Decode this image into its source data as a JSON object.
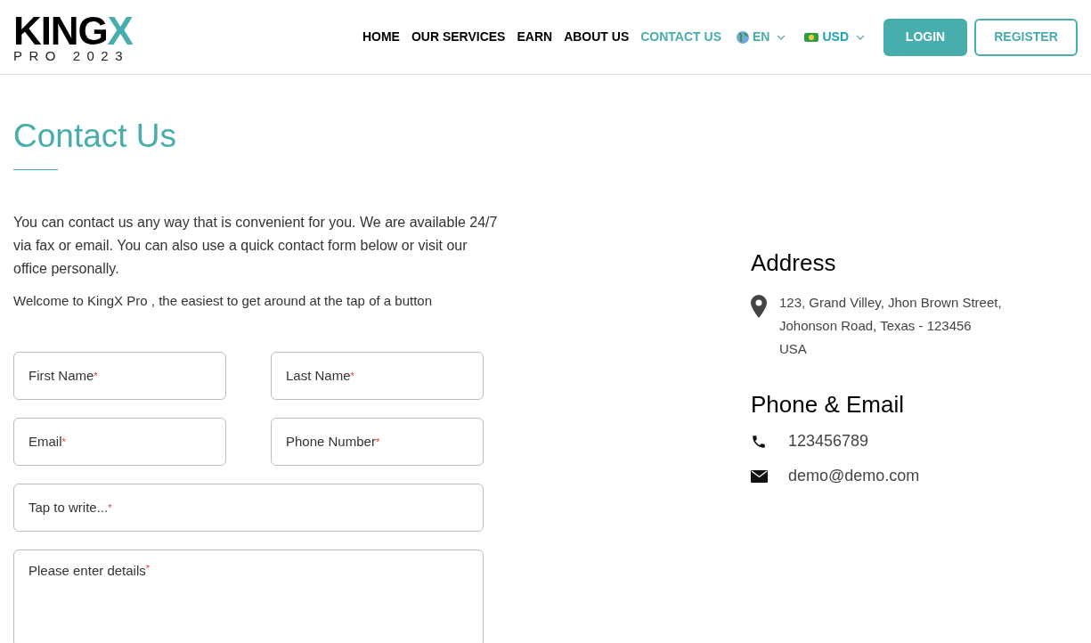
{
  "logo": {
    "main": "KING",
    "accent": "X",
    "sub": "PRO 2023"
  },
  "nav": [
    {
      "label": "HOME",
      "selected": false
    },
    {
      "label": "OUR SERVICES",
      "selected": false
    },
    {
      "label": "EARN",
      "selected": false
    },
    {
      "label": "ABOUT US",
      "selected": false
    },
    {
      "label": "CONTACT US",
      "selected": true
    }
  ],
  "language": {
    "value": "EN"
  },
  "currency": {
    "value": "USD"
  },
  "buttons": [
    {
      "label": "LOGIN",
      "kind": "filled"
    },
    {
      "label": "REGISTER",
      "kind": "outline"
    }
  ],
  "heading": "Contact Us",
  "intro": [
    "You can contact us any way that is convenient for you. We are available 24/7 via fax or email. You can also use a quick contact form below or visit our office personally.",
    "Welcome to KingX Pro , the easiest to get around at the tap of a button"
  ],
  "form": [
    {
      "label": "First Name",
      "required_mark": "*",
      "kind": "half"
    },
    {
      "label": "Last Name",
      "required_mark": "*",
      "kind": "half"
    },
    {
      "label": "Email",
      "required_mark": "*",
      "kind": "half"
    },
    {
      "label": "Phone Number",
      "required_mark": "*",
      "kind": "half"
    },
    {
      "label": "Tap to write...",
      "required_mark": "*",
      "kind": "full"
    },
    {
      "label": "Please enter details",
      "required_mark": "*",
      "kind": "textarea"
    }
  ],
  "address": {
    "title": "Address",
    "lines": [
      "123, Grand Villey, Jhon Brown Street,",
      "Johonson Road, Texas - 123456",
      "USA"
    ]
  },
  "contact": {
    "title": "Phone & Email",
    "phone": "123456789",
    "email": "demo@demo.com"
  }
}
